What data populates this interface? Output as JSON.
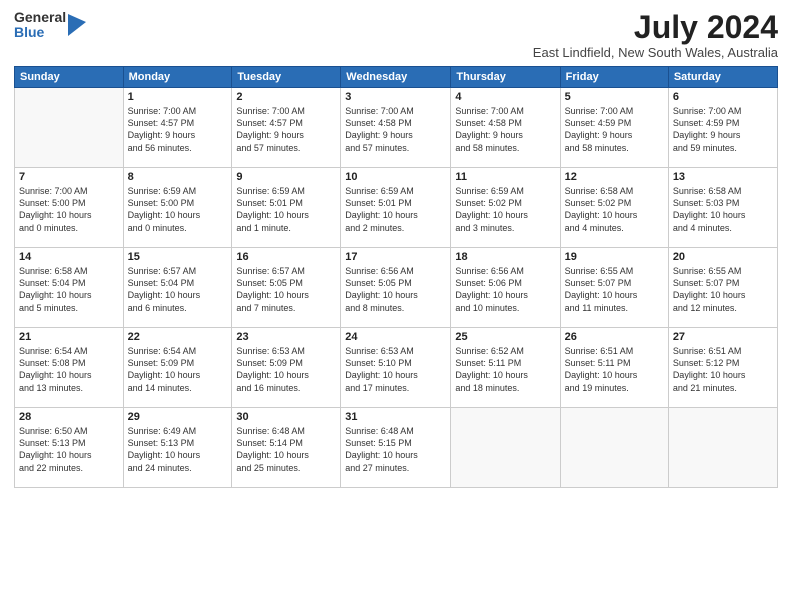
{
  "logo": {
    "general": "General",
    "blue": "Blue"
  },
  "title": "July 2024",
  "location": "East Lindfield, New South Wales, Australia",
  "headers": [
    "Sunday",
    "Monday",
    "Tuesday",
    "Wednesday",
    "Thursday",
    "Friday",
    "Saturday"
  ],
  "weeks": [
    [
      {
        "day": "",
        "info": ""
      },
      {
        "day": "1",
        "info": "Sunrise: 7:00 AM\nSunset: 4:57 PM\nDaylight: 9 hours\nand 56 minutes."
      },
      {
        "day": "2",
        "info": "Sunrise: 7:00 AM\nSunset: 4:57 PM\nDaylight: 9 hours\nand 57 minutes."
      },
      {
        "day": "3",
        "info": "Sunrise: 7:00 AM\nSunset: 4:58 PM\nDaylight: 9 hours\nand 57 minutes."
      },
      {
        "day": "4",
        "info": "Sunrise: 7:00 AM\nSunset: 4:58 PM\nDaylight: 9 hours\nand 58 minutes."
      },
      {
        "day": "5",
        "info": "Sunrise: 7:00 AM\nSunset: 4:59 PM\nDaylight: 9 hours\nand 58 minutes."
      },
      {
        "day": "6",
        "info": "Sunrise: 7:00 AM\nSunset: 4:59 PM\nDaylight: 9 hours\nand 59 minutes."
      }
    ],
    [
      {
        "day": "7",
        "info": "Sunrise: 7:00 AM\nSunset: 5:00 PM\nDaylight: 10 hours\nand 0 minutes."
      },
      {
        "day": "8",
        "info": "Sunrise: 6:59 AM\nSunset: 5:00 PM\nDaylight: 10 hours\nand 0 minutes."
      },
      {
        "day": "9",
        "info": "Sunrise: 6:59 AM\nSunset: 5:01 PM\nDaylight: 10 hours\nand 1 minute."
      },
      {
        "day": "10",
        "info": "Sunrise: 6:59 AM\nSunset: 5:01 PM\nDaylight: 10 hours\nand 2 minutes."
      },
      {
        "day": "11",
        "info": "Sunrise: 6:59 AM\nSunset: 5:02 PM\nDaylight: 10 hours\nand 3 minutes."
      },
      {
        "day": "12",
        "info": "Sunrise: 6:58 AM\nSunset: 5:02 PM\nDaylight: 10 hours\nand 4 minutes."
      },
      {
        "day": "13",
        "info": "Sunrise: 6:58 AM\nSunset: 5:03 PM\nDaylight: 10 hours\nand 4 minutes."
      }
    ],
    [
      {
        "day": "14",
        "info": "Sunrise: 6:58 AM\nSunset: 5:04 PM\nDaylight: 10 hours\nand 5 minutes."
      },
      {
        "day": "15",
        "info": "Sunrise: 6:57 AM\nSunset: 5:04 PM\nDaylight: 10 hours\nand 6 minutes."
      },
      {
        "day": "16",
        "info": "Sunrise: 6:57 AM\nSunset: 5:05 PM\nDaylight: 10 hours\nand 7 minutes."
      },
      {
        "day": "17",
        "info": "Sunrise: 6:56 AM\nSunset: 5:05 PM\nDaylight: 10 hours\nand 8 minutes."
      },
      {
        "day": "18",
        "info": "Sunrise: 6:56 AM\nSunset: 5:06 PM\nDaylight: 10 hours\nand 10 minutes."
      },
      {
        "day": "19",
        "info": "Sunrise: 6:55 AM\nSunset: 5:07 PM\nDaylight: 10 hours\nand 11 minutes."
      },
      {
        "day": "20",
        "info": "Sunrise: 6:55 AM\nSunset: 5:07 PM\nDaylight: 10 hours\nand 12 minutes."
      }
    ],
    [
      {
        "day": "21",
        "info": "Sunrise: 6:54 AM\nSunset: 5:08 PM\nDaylight: 10 hours\nand 13 minutes."
      },
      {
        "day": "22",
        "info": "Sunrise: 6:54 AM\nSunset: 5:09 PM\nDaylight: 10 hours\nand 14 minutes."
      },
      {
        "day": "23",
        "info": "Sunrise: 6:53 AM\nSunset: 5:09 PM\nDaylight: 10 hours\nand 16 minutes."
      },
      {
        "day": "24",
        "info": "Sunrise: 6:53 AM\nSunset: 5:10 PM\nDaylight: 10 hours\nand 17 minutes."
      },
      {
        "day": "25",
        "info": "Sunrise: 6:52 AM\nSunset: 5:11 PM\nDaylight: 10 hours\nand 18 minutes."
      },
      {
        "day": "26",
        "info": "Sunrise: 6:51 AM\nSunset: 5:11 PM\nDaylight: 10 hours\nand 19 minutes."
      },
      {
        "day": "27",
        "info": "Sunrise: 6:51 AM\nSunset: 5:12 PM\nDaylight: 10 hours\nand 21 minutes."
      }
    ],
    [
      {
        "day": "28",
        "info": "Sunrise: 6:50 AM\nSunset: 5:13 PM\nDaylight: 10 hours\nand 22 minutes."
      },
      {
        "day": "29",
        "info": "Sunrise: 6:49 AM\nSunset: 5:13 PM\nDaylight: 10 hours\nand 24 minutes."
      },
      {
        "day": "30",
        "info": "Sunrise: 6:48 AM\nSunset: 5:14 PM\nDaylight: 10 hours\nand 25 minutes."
      },
      {
        "day": "31",
        "info": "Sunrise: 6:48 AM\nSunset: 5:15 PM\nDaylight: 10 hours\nand 27 minutes."
      },
      {
        "day": "",
        "info": ""
      },
      {
        "day": "",
        "info": ""
      },
      {
        "day": "",
        "info": ""
      }
    ]
  ]
}
